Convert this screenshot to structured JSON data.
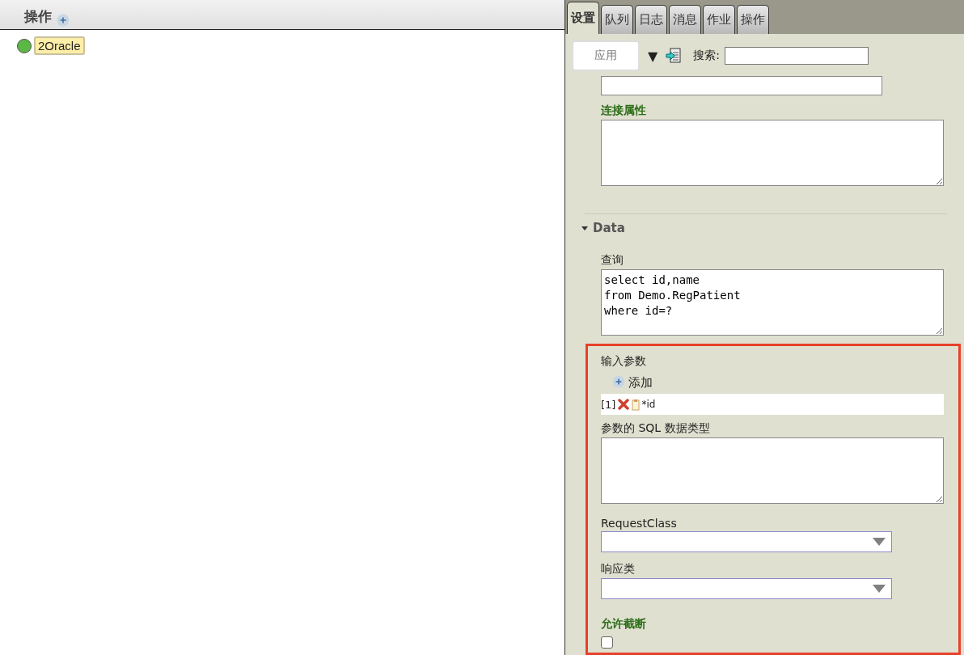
{
  "left_pane": {
    "title": "操作",
    "nodes": [
      {
        "label": "2Oracle",
        "color": "#5cb845",
        "selected": true
      }
    ]
  },
  "tabs": [
    {
      "label": "设置",
      "selected": true
    },
    {
      "label": "队列",
      "selected": false
    },
    {
      "label": "日志",
      "selected": false
    },
    {
      "label": "消息",
      "selected": false
    },
    {
      "label": "作业",
      "selected": false
    },
    {
      "label": "操作",
      "selected": false
    }
  ],
  "toolbar": {
    "apply_button": "应用",
    "dropdown_glyph": "▼",
    "search_label": "搜索:"
  },
  "connection": {
    "label": "连接属性"
  },
  "data_section": {
    "title": "Data",
    "expanded": true,
    "query_label": "查询",
    "query": "select id,name\nfrom Demo.RegPatient\nwhere id=?",
    "input_params": {
      "label": "输入参数",
      "add_label": "添加",
      "params": [
        {
          "index": "[1]",
          "name": "*id"
        }
      ]
    },
    "sql_types_label": "参数的 SQL 数据类型",
    "request_class": {
      "label": "RequestClass"
    },
    "response_class": {
      "label": "响应类"
    },
    "allow_truncation": {
      "label": "允许截断",
      "checked": false
    }
  }
}
